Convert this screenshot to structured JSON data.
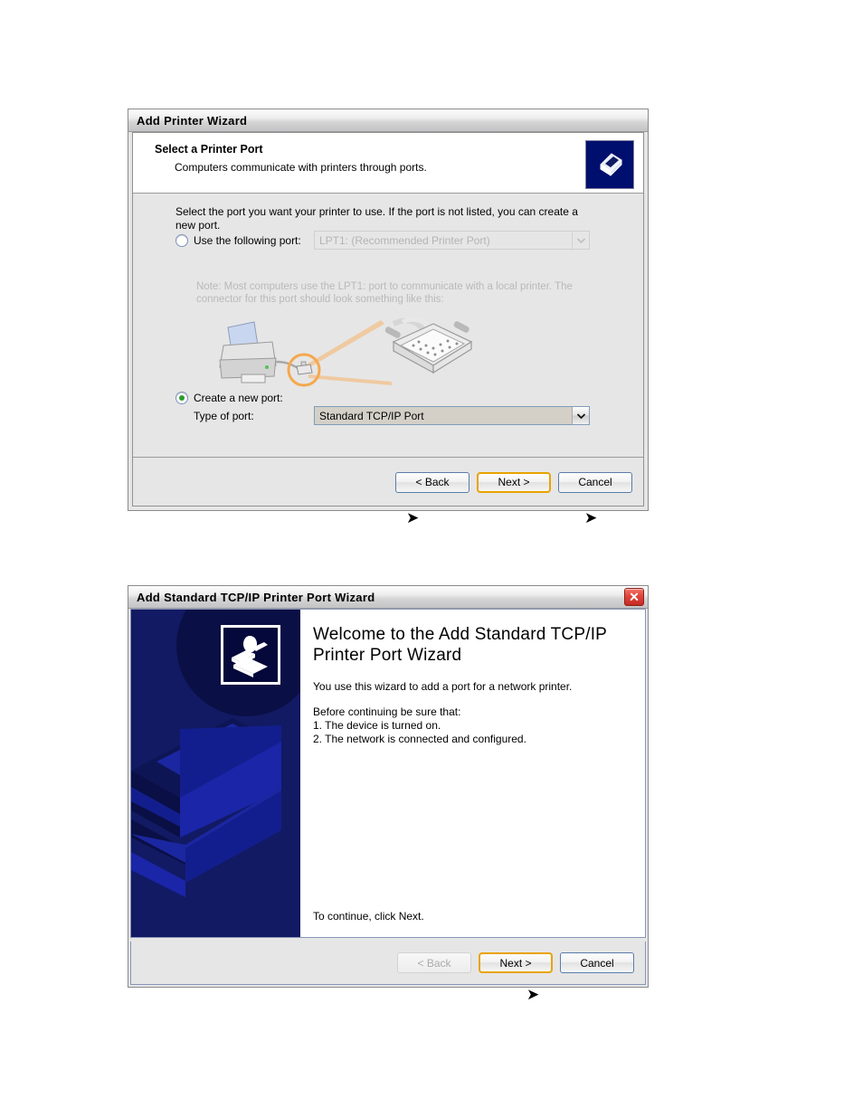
{
  "dialog1": {
    "name": "Add Printer Wizard",
    "titlebar": {
      "title": "Add Printer Wizard"
    },
    "header": {
      "title": "Select a Printer Port",
      "subtitle": "Computers communicate with printers through ports.",
      "icon": "printer-icon"
    },
    "body": {
      "intro": "Select the port you want your printer to use.  If the port is not listed, you can create a new port.",
      "use_existing": {
        "radio_label": "Use the following port:",
        "selected": false,
        "port_value": "LPT1: (Recommended Printer Port)",
        "disabled": true
      },
      "note": "Note: Most computers use the LPT1: port to communicate with a local printer. The connector for this port should look something like this:",
      "illustration": "printer-parallel-connector-illustration",
      "create_new": {
        "radio_label": "Create a new port:",
        "selected": true,
        "type_label": "Type of port:",
        "type_value": "Standard TCP/IP Port"
      }
    },
    "buttons": {
      "back": "< Back",
      "next": "Next >",
      "cancel": "Cancel"
    },
    "pointers": [
      "next-button-pointer",
      "cancel-button-pointer"
    ]
  },
  "dialog2": {
    "name": "Add Standard TCP/IP Printer Port Wizard",
    "titlebar": {
      "title": "Add Standard TCP/IP Printer Port Wizard",
      "close": "close-icon"
    },
    "welcome": {
      "heading": "Welcome to the Add Standard TCP/IP Printer Port Wizard",
      "paragraph": "You use this wizard to add a port for a network printer.",
      "before_heading": "Before continuing be sure that:",
      "steps": [
        "1.  The device is turned on.",
        "2.  The network is connected and configured."
      ],
      "continue": "To continue, click Next.",
      "side_icon": "network-printer-icon"
    },
    "buttons": {
      "back": "< Back",
      "back_disabled": true,
      "next": "Next >",
      "cancel": "Cancel"
    },
    "pointers": [
      "next-button-pointer"
    ]
  },
  "colors": {
    "title_text": "#000000",
    "dialog_face": "#e6e6e6",
    "header_bg": "#ffffff",
    "default_button_focus": "#e8a300",
    "radio_dot": "#2e9b2e",
    "wizard_side_blue": "#121a63",
    "close_red": "#d63a30",
    "disabled_text": "#b9b9b9"
  }
}
